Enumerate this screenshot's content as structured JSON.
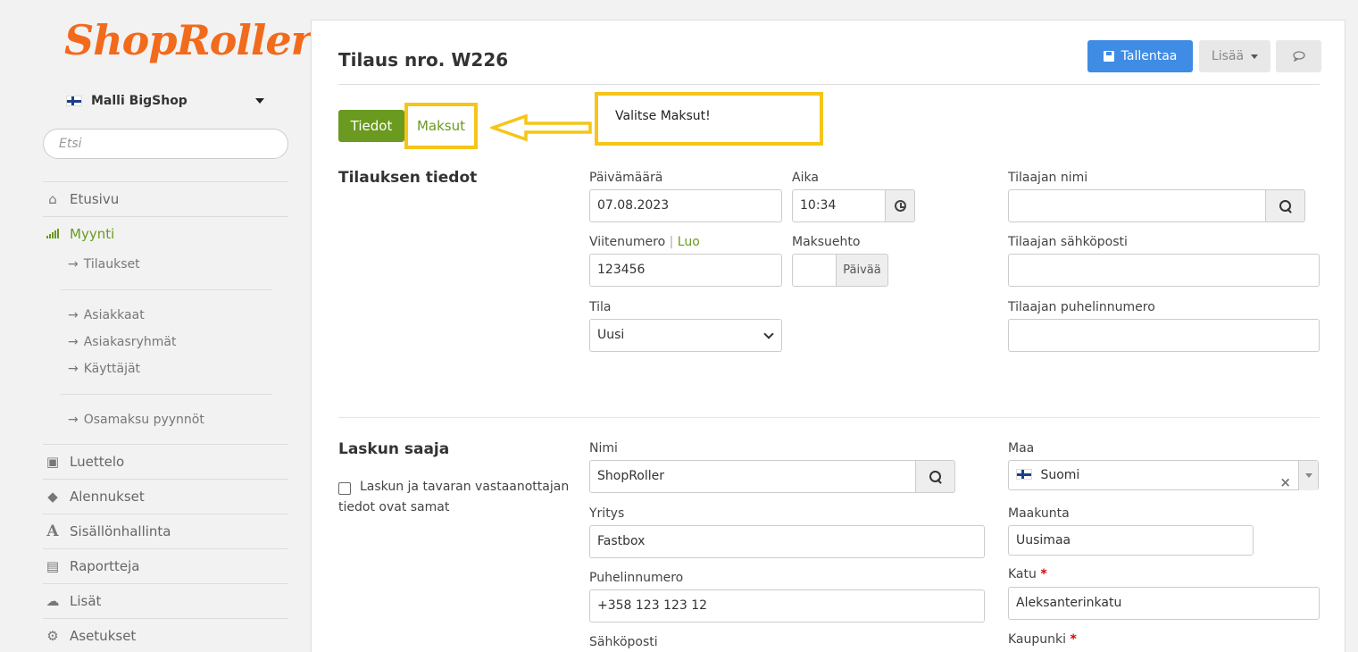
{
  "brand": {
    "logo": "ShopRoller",
    "logo_color": "#f26a1b"
  },
  "shop_selector": {
    "label": "Malli BigShop"
  },
  "search": {
    "placeholder": "Etsi"
  },
  "nav": {
    "etusivu": "Etusivu",
    "myynti": "Myynti",
    "tilaukset": "Tilaukset",
    "asiakkaat": "Asiakkaat",
    "asiakasryhmat": "Asiakasryhmät",
    "kayttajat": "Käyttäjät",
    "osamaksu": "Osamaksu pyynnöt",
    "luettelo": "Luettelo",
    "alennukset": "Alennukset",
    "sisallonhallinta": "Sisällönhallinta",
    "raportteja": "Raportteja",
    "lisat": "Lisät",
    "asetukset": "Asetukset"
  },
  "page": {
    "title": "Tilaus nro. W226",
    "save_label": "Tallentaa",
    "more_label": "Lisää",
    "tabs": {
      "tiedot": "Tiedot",
      "maksut": "Maksut"
    },
    "callout": "Valitse Maksut!"
  },
  "order_info": {
    "section_title": "Tilauksen tiedot",
    "date_label": "Päivämäärä",
    "date_value": "07.08.2023",
    "time_label": "Aika",
    "time_value": "10:34",
    "ref_label": "Viitenumero",
    "ref_link": "Luo",
    "ref_value": "123456",
    "terms_label": "Maksuehto",
    "terms_value": "",
    "terms_unit": "Päivää",
    "status_label": "Tila",
    "status_value": "Uusi",
    "customer_name_label": "Tilaajan nimi",
    "customer_name_value": "",
    "customer_email_label": "Tilaajan sähköposti",
    "customer_email_value": "",
    "customer_phone_label": "Tilaajan puhelinnumero",
    "customer_phone_value": ""
  },
  "billing": {
    "section_title": "Laskun saaja",
    "same_checkbox_label": "Laskun ja tavaran vastaanottajan tiedot ovat samat",
    "name_label": "Nimi",
    "name_value": "ShopRoller",
    "company_label": "Yritys",
    "company_value": "Fastbox",
    "phone_label": "Puhelinnumero",
    "phone_value": "+358 123 123 12",
    "email_label": "Sähköposti",
    "country_label": "Maa",
    "country_value": "Suomi",
    "region_label": "Maakunta",
    "region_value": "Uusimaa",
    "street_label": "Katu",
    "street_value": "Aleksanterinkatu",
    "city_label": "Kaupunki",
    "required_mark": "*"
  },
  "colors": {
    "primary_blue": "#3f8ce4",
    "green": "#6a9a1f",
    "highlight": "#f5c518"
  }
}
